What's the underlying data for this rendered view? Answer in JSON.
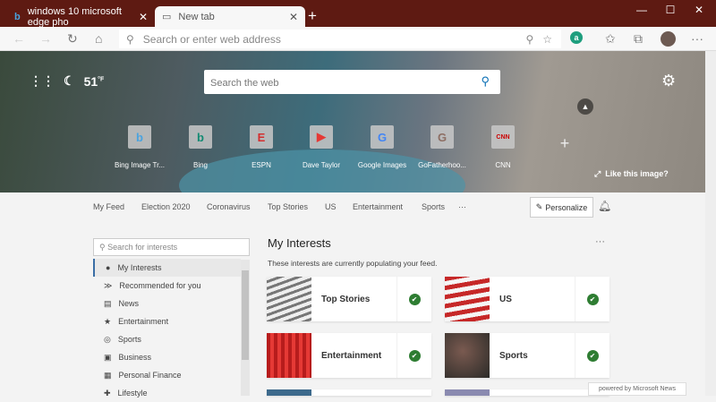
{
  "browser": {
    "tabs": [
      {
        "label": "windows 10 microsoft edge pho",
        "icon": "bing-icon",
        "active": false
      },
      {
        "label": "New tab",
        "icon": "newtab-icon",
        "active": true
      }
    ],
    "address_placeholder": "Search or enter web address",
    "theme_color": "#5e1a12"
  },
  "hero": {
    "weather": {
      "temp": "51",
      "unit": "°F",
      "icon": "moon-icon"
    },
    "search_placeholder": "Search the web",
    "quick_links": [
      {
        "label": "Bing Image Tr...",
        "glyph": "b",
        "color": "#4aa3df"
      },
      {
        "label": "Bing",
        "glyph": "b",
        "color": "#138a72"
      },
      {
        "label": "ESPN",
        "glyph": "E",
        "color": "#d32f2f"
      },
      {
        "label": "Dave Taylor",
        "glyph": "▶",
        "color": "#e53935"
      },
      {
        "label": "Google Images",
        "glyph": "G",
        "color": "#4285f4"
      },
      {
        "label": "GoFatherhoo...",
        "glyph": "G",
        "color": "#8d6e63"
      },
      {
        "label": "CNN",
        "glyph": "CNN",
        "color": "#cc0000"
      }
    ],
    "like_image": "Like this image?"
  },
  "nav": {
    "items": [
      "My Feed",
      "Election 2020",
      "Coronavirus",
      "Top Stories",
      "US",
      "Entertainment",
      "Sports",
      "···"
    ],
    "personalize": "Personalize"
  },
  "sidebar": {
    "search_placeholder": "Search for interests",
    "items": [
      {
        "label": "My Interests",
        "icon": "●"
      },
      {
        "label": "Recommended for you",
        "icon": "≫"
      },
      {
        "label": "News",
        "icon": "▤"
      },
      {
        "label": "Entertainment",
        "icon": "★"
      },
      {
        "label": "Sports",
        "icon": "◎"
      },
      {
        "label": "Business",
        "icon": "▣"
      },
      {
        "label": "Personal Finance",
        "icon": "▦"
      },
      {
        "label": "Lifestyle",
        "icon": "✚"
      }
    ]
  },
  "main": {
    "title": "My Interests",
    "subtitle": "These interests are currently populating your feed.",
    "cards": [
      {
        "label": "Top Stories",
        "selected": true
      },
      {
        "label": "US",
        "selected": true
      },
      {
        "label": "Entertainment",
        "selected": true
      },
      {
        "label": "Sports",
        "selected": true
      }
    ]
  },
  "footer": {
    "powered": "powered by Microsoft News"
  }
}
